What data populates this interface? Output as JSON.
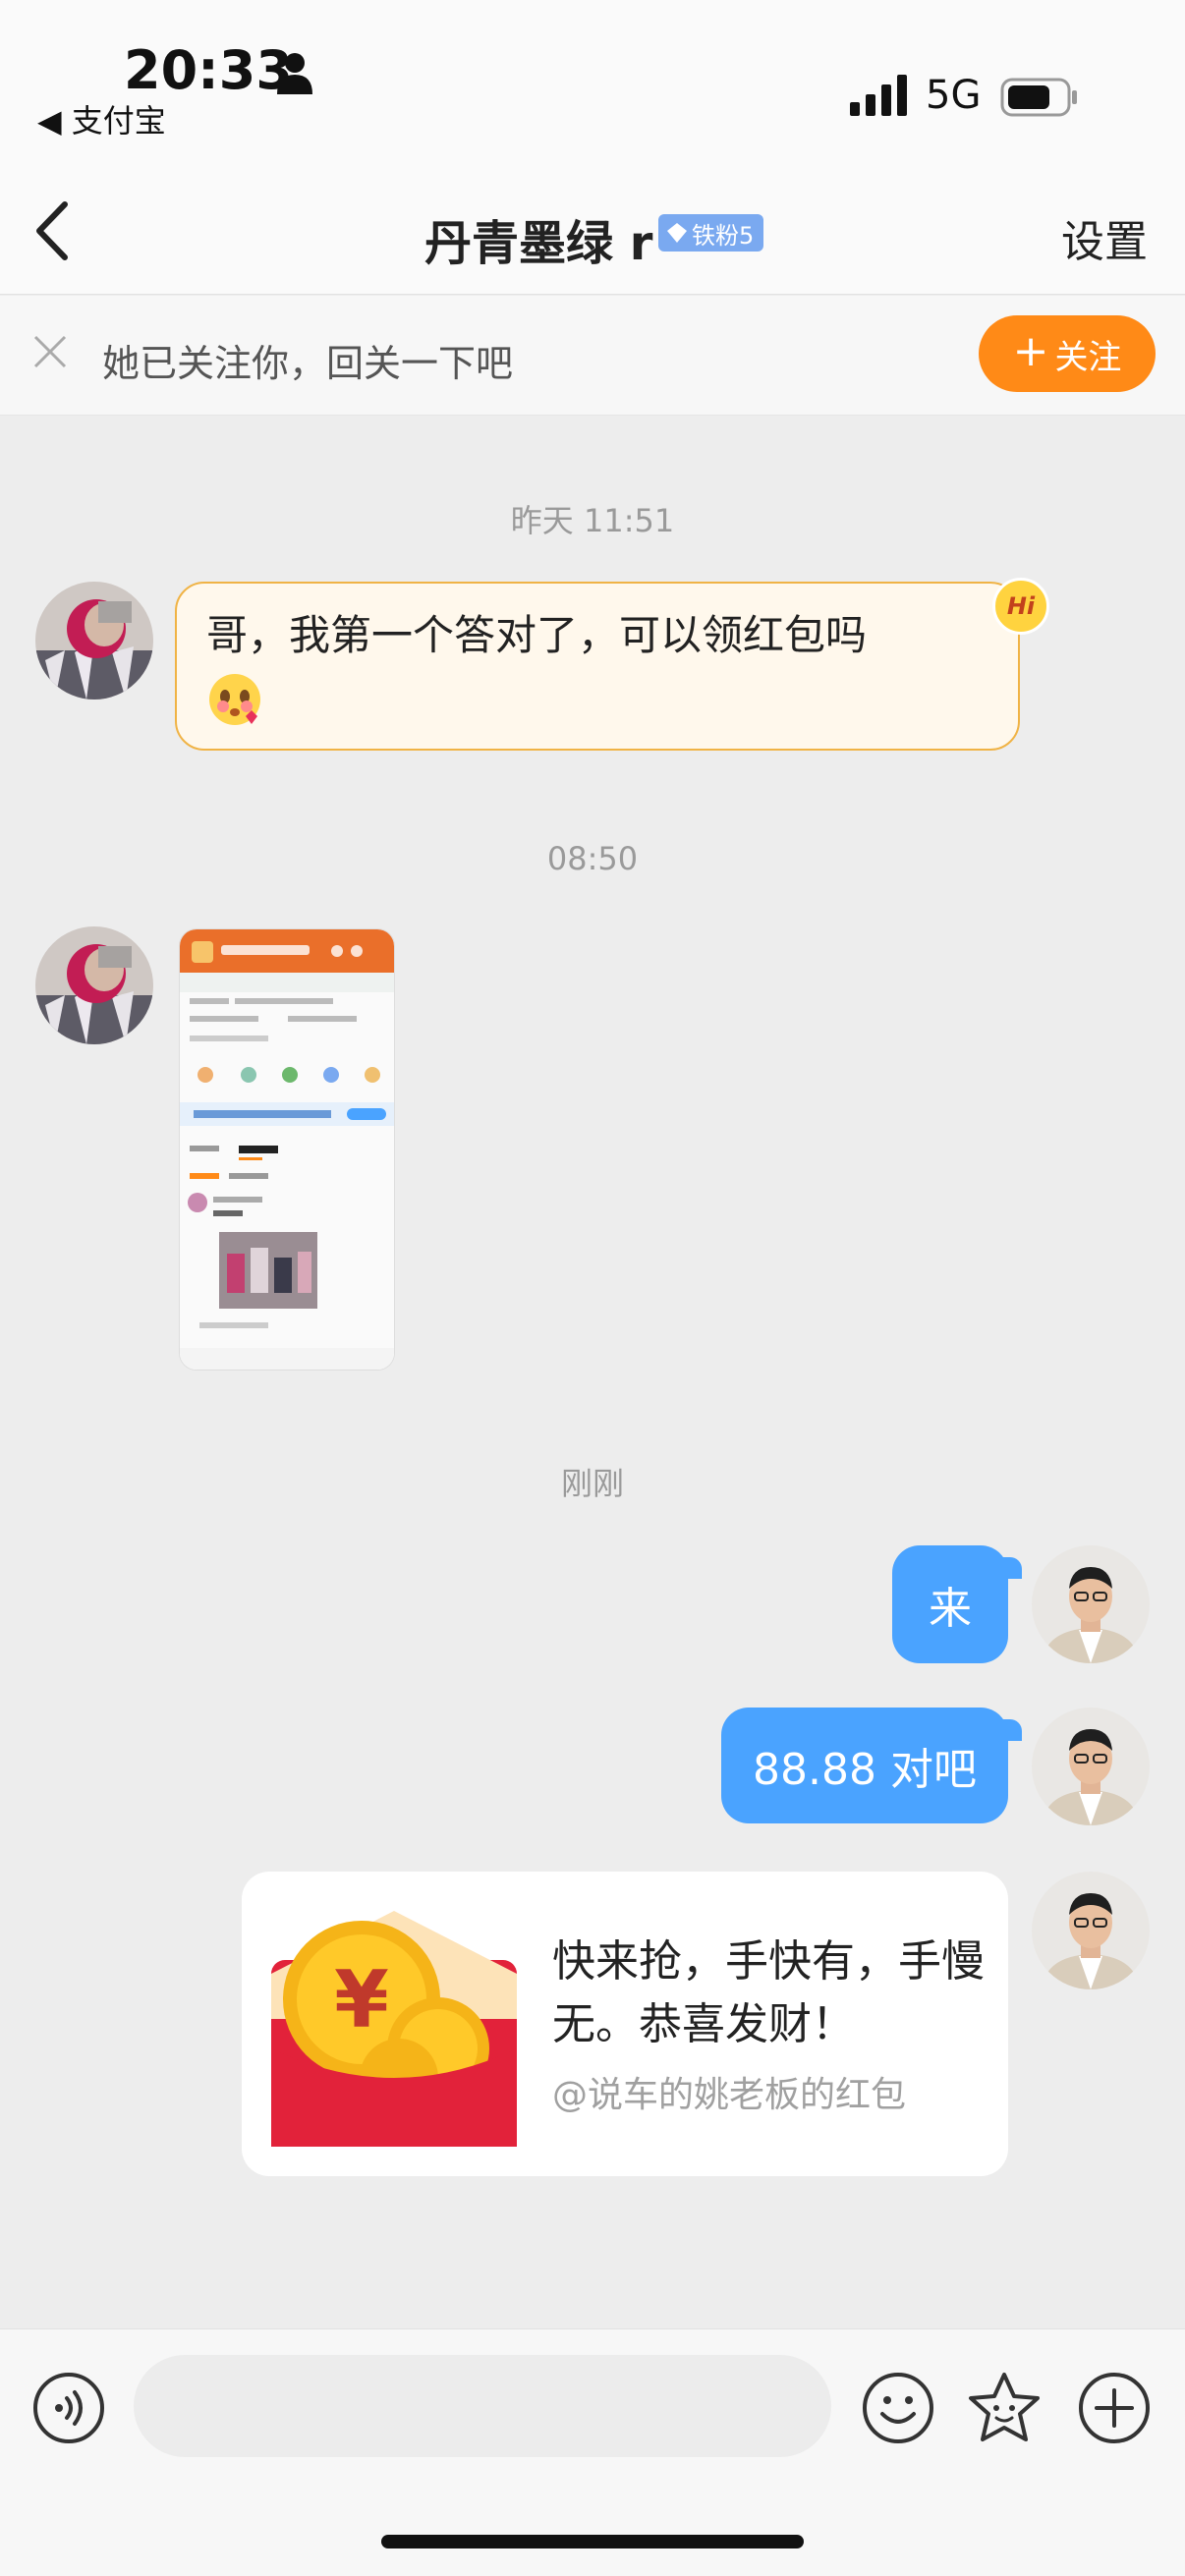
{
  "status_bar": {
    "time": "20:33",
    "back_app": "◀ 支付宝",
    "network": "5G"
  },
  "nav": {
    "title": "丹青墨绿 r",
    "badge": "铁粉5",
    "settings": "设置"
  },
  "follow_banner": {
    "hint": "她已关注你，回关一下吧",
    "button": "关注"
  },
  "messages": {
    "ts1": "昨天 11:51",
    "msg1": "哥，我第一个答对了，可以领红包吗",
    "hi_badge": "Hi",
    "ts2": "08:50",
    "ts3": "刚刚",
    "msg2": "来",
    "msg3": "88.88 对吧",
    "redpacket_title": "快来抢，手快有，手慢无。恭喜发财！",
    "redpacket_sub": "@说车的姚老板的红包"
  },
  "input": {
    "placeholder": ""
  },
  "colors": {
    "accent_blue": "#4aa3ff",
    "follow_orange": "#ff8a17",
    "redpacket_red": "#e2223a",
    "hi_border": "#f0b345"
  }
}
